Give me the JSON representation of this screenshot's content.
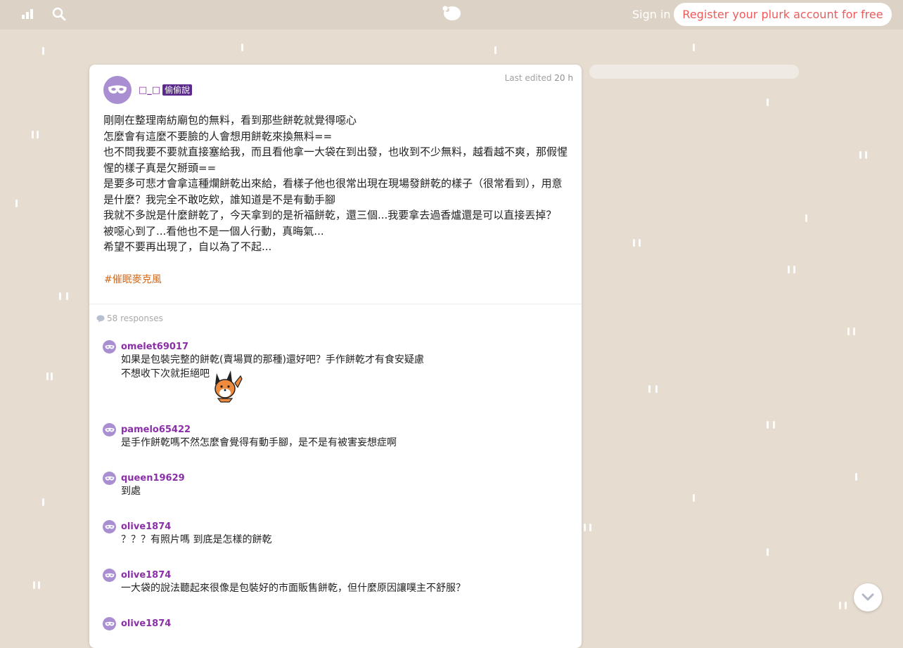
{
  "nav": {
    "signin_label": "Sign in",
    "register_label": "Register your plurk account for free",
    "left_icons": [
      "timeline-chart-icon",
      "search-icon"
    ],
    "logo_icon": "plurk-logo-icon",
    "accent_color": "#ef5a5a"
  },
  "post": {
    "author": "□_□",
    "badge": "偷偷說",
    "last_edited_label": "Last edited",
    "last_edited_time": "20 h",
    "body_lines": [
      "剛剛在整理南紡廟包的無料，看到那些餅乾就覺得噁心",
      "怎麼會有這麼不要臉的人會想用餅乾來換無料==",
      "也不問我要不要就直接塞給我，而且看他拿一大袋在到出發，也收到不少無料，越看越不爽，那假惺惺的樣子真是欠掰頭==",
      "是要多可悲才會拿這種爛餅乾出來給，看樣子他也很常出現在現場發餅乾的樣子（很常看到），用意是什麼？我完全不敢吃欸，誰知道是不是有動手腳",
      "我就不多說是什麼餅乾了，今天拿到的是祈福餅乾，還三個...我要拿去過香爐還是可以直接丟掉？",
      "被噁心到了...看他也不是一個人行動，真晦氣...",
      "希望不要再出現了，自以為了不起..."
    ],
    "hashtag": "#催眠麥克風"
  },
  "responses_count_label": "58 responses",
  "responses": [
    {
      "user": "omelet69017",
      "lines": [
        "如果是包裝完整的餅乾(賣場買的那種)還好吧？手作餅乾才有食安疑慮",
        "不想收下次就拒絕吧"
      ],
      "sticker": "fox-sticker"
    },
    {
      "user": "pamelo65422",
      "lines": [
        "是手作餅乾嗎不然怎麼會覺得有動手腳，是不是有被害妄想症啊"
      ]
    },
    {
      "user": "queen19629",
      "lines": [
        "到處"
      ]
    },
    {
      "user": "olive1874",
      "lines": [
        "？？？有照片嗎 到底是怎樣的餅乾"
      ]
    },
    {
      "user": "olive1874",
      "lines": [
        "一大袋的說法聽起來很像是包裝好的市面販售餅乾，但什麼原因讓噗主不舒服？"
      ]
    },
    {
      "user": "olive1874",
      "lines": []
    }
  ],
  "colors": {
    "background": "#e6ddd0",
    "username": "#8b2fa8",
    "hashtag": "#d06a1f",
    "avatar": "#a98fd1"
  }
}
